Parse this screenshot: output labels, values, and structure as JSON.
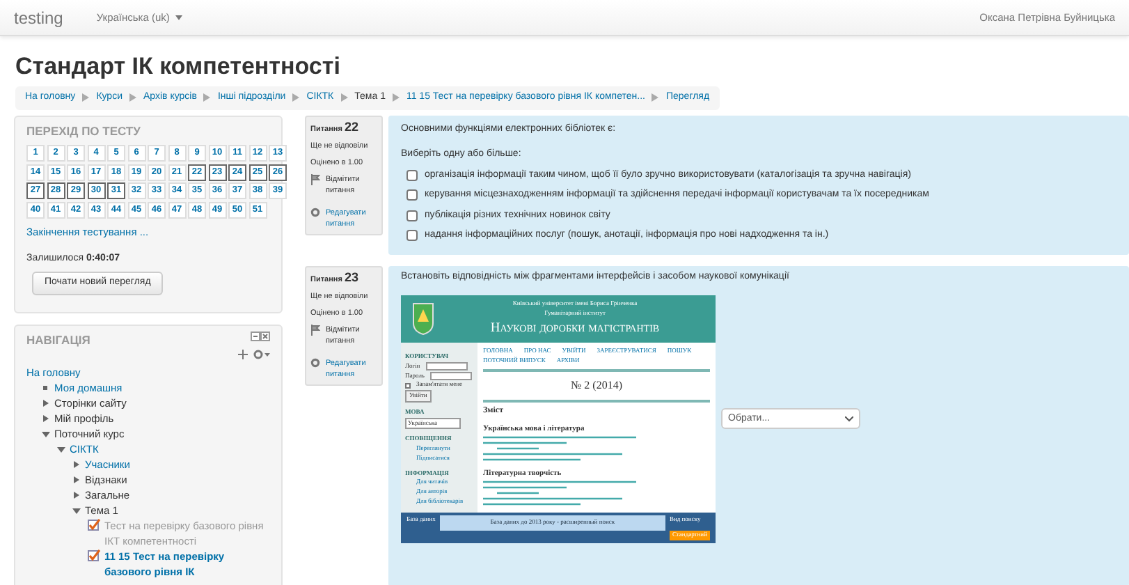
{
  "navbar": {
    "brand": "testing",
    "language": "Українська (uk)",
    "user": "Оксана Петрівна Буйницька"
  },
  "page_title": "Стандарт ІК компетентності",
  "breadcrumb": [
    {
      "label": "На головну",
      "kind": "link"
    },
    {
      "label": "Курси",
      "kind": "link"
    },
    {
      "label": "Архів курсів",
      "kind": "link"
    },
    {
      "label": "Інші підрозділи",
      "kind": "link"
    },
    {
      "label": "СІКТК",
      "kind": "link"
    },
    {
      "label": "Тема 1",
      "kind": "text"
    },
    {
      "label": "11 15 Тест на перевірку базового рівня ІК компетен...",
      "kind": "link"
    },
    {
      "label": "Перегляд",
      "kind": "link"
    }
  ],
  "quiz_nav": {
    "title": "ПЕРЕХІД ПО ТЕСТУ",
    "questions": [
      {
        "label": "1",
        "current": false
      },
      {
        "label": "2",
        "current": false
      },
      {
        "label": "3",
        "current": false
      },
      {
        "label": "4",
        "current": false
      },
      {
        "label": "5",
        "current": false
      },
      {
        "label": "6",
        "current": false
      },
      {
        "label": "7",
        "current": false
      },
      {
        "label": "8",
        "current": false
      },
      {
        "label": "9",
        "current": false
      },
      {
        "label": "10",
        "current": false
      },
      {
        "label": "11",
        "current": false
      },
      {
        "label": "12",
        "current": false
      },
      {
        "label": "13",
        "current": false
      },
      {
        "label": "14",
        "current": false
      },
      {
        "label": "15",
        "current": false
      },
      {
        "label": "16",
        "current": false
      },
      {
        "label": "17",
        "current": false
      },
      {
        "label": "18",
        "current": false
      },
      {
        "label": "19",
        "current": false
      },
      {
        "label": "20",
        "current": false
      },
      {
        "label": "21",
        "current": false
      },
      {
        "label": "22",
        "current": true
      },
      {
        "label": "23",
        "current": true
      },
      {
        "label": "24",
        "current": true
      },
      {
        "label": "25",
        "current": true
      },
      {
        "label": "26",
        "current": true
      },
      {
        "label": "27",
        "current": true
      },
      {
        "label": "28",
        "current": true
      },
      {
        "label": "29",
        "current": true
      },
      {
        "label": "30",
        "current": true
      },
      {
        "label": "31",
        "current": true
      },
      {
        "label": "32",
        "current": false
      },
      {
        "label": "33",
        "current": false
      },
      {
        "label": "34",
        "current": false
      },
      {
        "label": "35",
        "current": false
      },
      {
        "label": "36",
        "current": false
      },
      {
        "label": "37",
        "current": false
      },
      {
        "label": "38",
        "current": false
      },
      {
        "label": "39",
        "current": false
      },
      {
        "label": "40",
        "current": false
      },
      {
        "label": "41",
        "current": false
      },
      {
        "label": "42",
        "current": false
      },
      {
        "label": "43",
        "current": false
      },
      {
        "label": "44",
        "current": false
      },
      {
        "label": "45",
        "current": false
      },
      {
        "label": "46",
        "current": false
      },
      {
        "label": "47",
        "current": false
      },
      {
        "label": "48",
        "current": false
      },
      {
        "label": "49",
        "current": false
      },
      {
        "label": "50",
        "current": false
      },
      {
        "label": "51",
        "current": false
      }
    ],
    "finish_link": "Закінчення тестування ...",
    "time_label": "Залишилося",
    "time_value": "0:40:07",
    "restart_button": "Почати новий перегляд"
  },
  "navigation": {
    "title": "НАВІГАЦІЯ",
    "items": [
      {
        "label": "На головну",
        "kind": "root",
        "linked": true,
        "children": [
          {
            "label": "Моя домашня",
            "kind": "leaf",
            "linked": true
          },
          {
            "label": "Сторінки сайту",
            "kind": "branch",
            "linked": false,
            "expanded": false
          },
          {
            "label": "Мій профіль",
            "kind": "branch",
            "linked": false,
            "expanded": false
          },
          {
            "label": "Поточний курс",
            "kind": "branch",
            "linked": false,
            "expanded": true,
            "children": [
              {
                "label": "СІКТК",
                "kind": "branch",
                "linked": true,
                "expanded": true,
                "children": [
                  {
                    "label": "Учасники",
                    "kind": "branch",
                    "linked": true,
                    "expanded": false
                  },
                  {
                    "label": "Відзнаки",
                    "kind": "branch",
                    "linked": false,
                    "expanded": false
                  },
                  {
                    "label": "Загальне",
                    "kind": "branch",
                    "linked": false,
                    "expanded": false
                  },
                  {
                    "label": "Тема 1",
                    "kind": "branch",
                    "linked": false,
                    "expanded": true,
                    "children": [
                      {
                        "label": "Тест на перевірку базового рівня ІКТ компетентності",
                        "kind": "activity",
                        "current": false
                      },
                      {
                        "label": "11 15 Тест на перевірку базового рівня ІК",
                        "kind": "activity",
                        "current": true
                      }
                    ]
                  }
                ]
              }
            ]
          }
        ]
      }
    ]
  },
  "questions": [
    {
      "kind": "multichoice",
      "heading": "Питання",
      "number": "22",
      "status": "Ще не відповіли",
      "mark": "Оцінено в 1.00",
      "flag_link": "Відмітити питання",
      "edit_link": "Редагувати питання",
      "text": "Основними функціями електронних бібліотек є:",
      "prompt": "Виберіть одну або більше:",
      "options": [
        {
          "label": "організація інформації таким чином, щоб її було зручно використовувати (каталогізація та зручна навігація)",
          "checked": false
        },
        {
          "label": "керування місцезнаходженням інформації та здійснення передачі інформації користувачам та їх посередникам",
          "checked": false
        },
        {
          "label": "публікація різних технічних новинок світу",
          "checked": false
        },
        {
          "label": "надання інформаційних послуг (пошук, анотації, інформація про нові надходження та ін.)",
          "checked": false
        }
      ]
    },
    {
      "kind": "match",
      "heading": "Питання",
      "number": "23",
      "status": "Ще не відповіли",
      "mark": "Оцінено в 1.00",
      "flag_link": "Відмітити питання",
      "edit_link": "Редагувати питання",
      "text": "Встановіть відповідність між фрагментами інтерфейсів і засобом наукової комунікації",
      "screenshot": {
        "institution": "Київський університет імені Бориса Грінченка",
        "institute": "Гуманітарний інститут",
        "site_title": "Наукові доробки магістрантів",
        "menu": [
          "ГОЛОВНА",
          "ПРО НАС",
          "УВІЙТИ",
          "ЗАРЕЄСТРУВАТИСЯ",
          "ПОШУК",
          "ПОТОЧНИЙ ВИПУСК",
          "АРХІВИ"
        ],
        "issue": "№ 2 (2014)",
        "contents": "Зміст",
        "sections": [
          "Українська мова і література",
          "Літературна творчість"
        ],
        "sidebar": [
          {
            "title": "КОРИСТУВАЧ",
            "kind": "login",
            "fields": [
              "Логін",
              "Пароль"
            ],
            "remember": "Запам'ятати мене",
            "remember_checked": false,
            "button": "Увійти"
          },
          {
            "title": "МОВА",
            "kind": "select",
            "value": "Українська"
          },
          {
            "title": "СПОВІЩЕННЯ",
            "kind": "list",
            "items": [
              "Переглянути",
              "Підписатися"
            ]
          },
          {
            "title": "ІНФОРМАЦІЯ",
            "kind": "list",
            "items": [
              "Для читачів",
              "Для авторів",
              "Для бібліотекарів"
            ]
          }
        ],
        "bottom": {
          "left": "База даних",
          "center": "База даних до 2013 року - расширенный поиск",
          "right": "Вид поиску",
          "right_value": "Стандартний"
        }
      },
      "select": {
        "value": "Обрати..."
      }
    }
  ]
}
